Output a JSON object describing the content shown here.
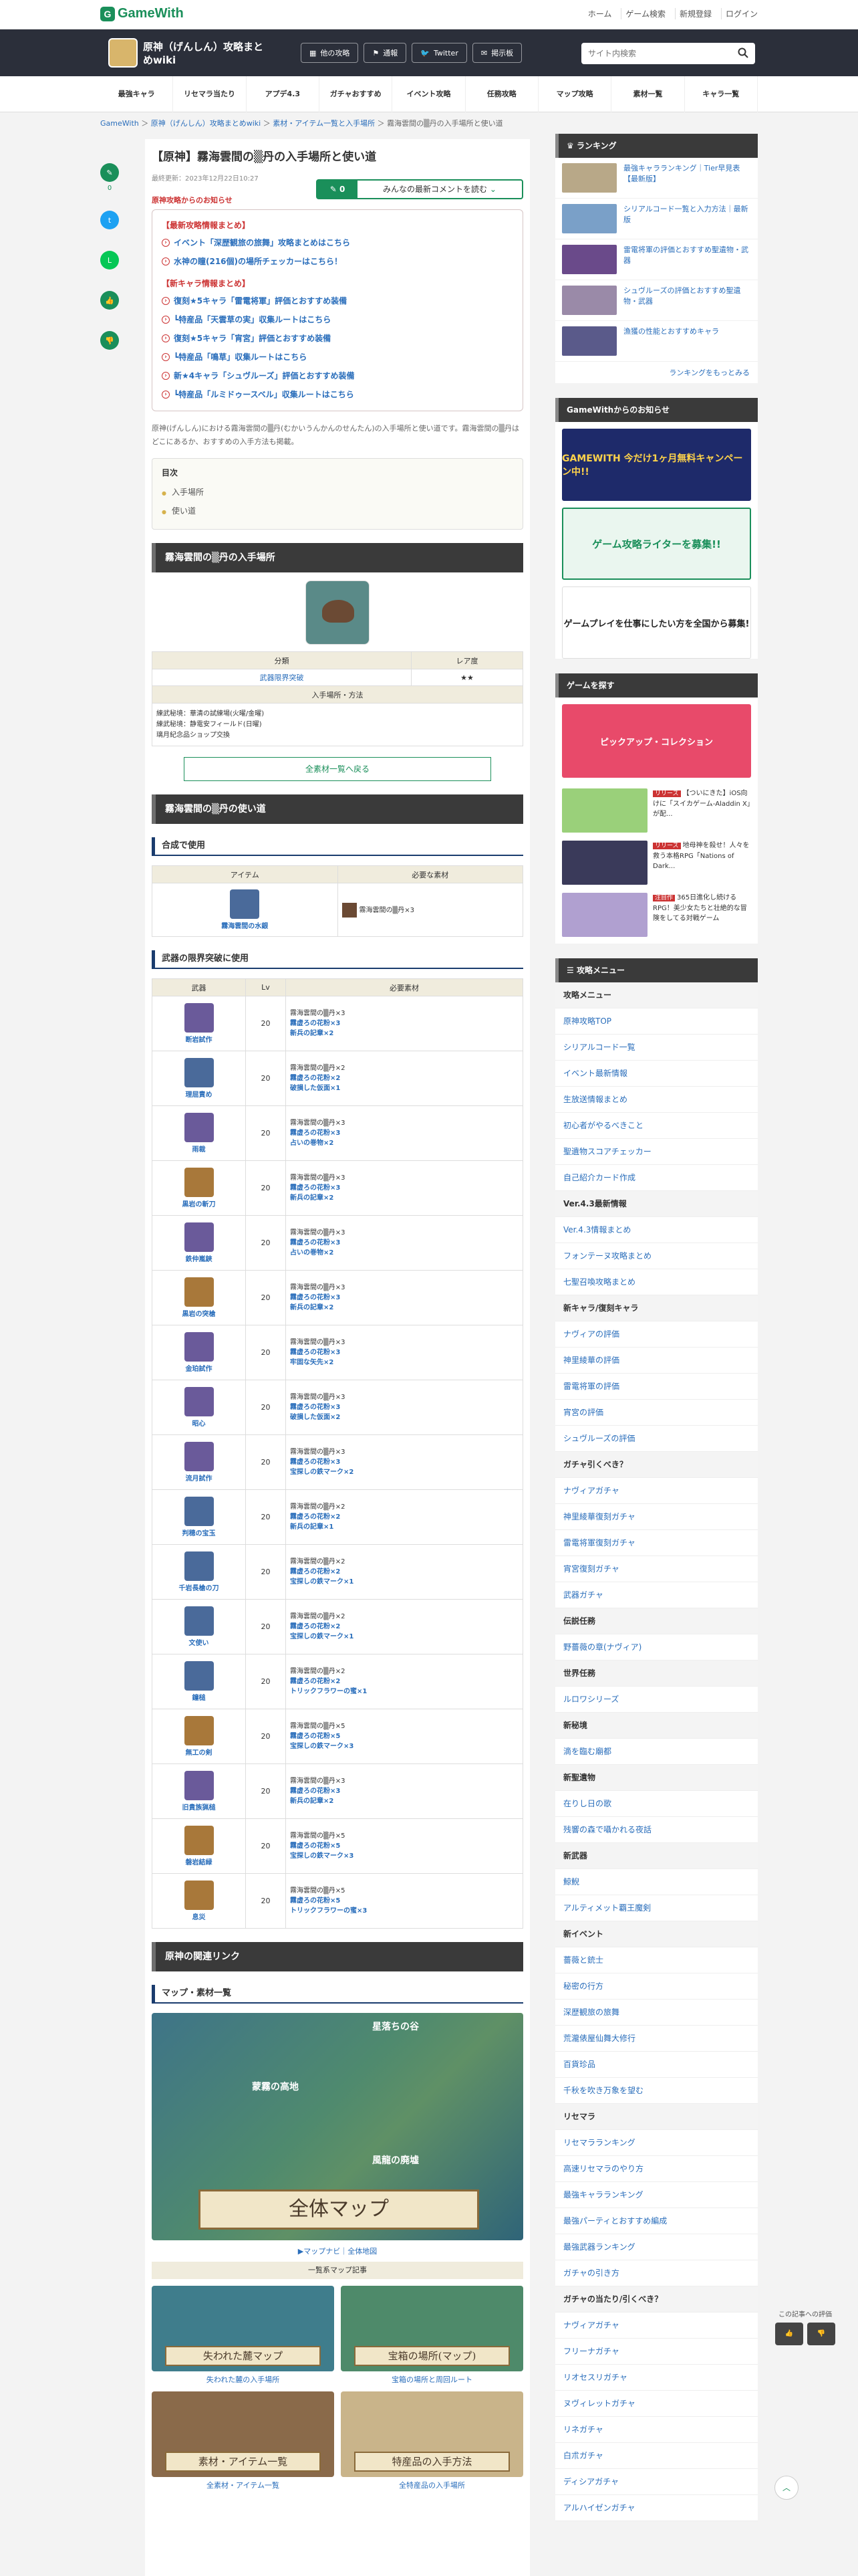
{
  "site": {
    "logo": "GameWith"
  },
  "topnav": {
    "home": "ホーム",
    "game_search": "ゲーム検索",
    "register": "新規登録",
    "login": "ログイン"
  },
  "game": {
    "title": "原神（げんしん）攻略まとめwiki",
    "buttons": [
      "他の攻略",
      "通報",
      "Twitter",
      "掲示板"
    ],
    "search_placeholder": "サイト内検索"
  },
  "tabs": [
    "最強キャラ",
    "リセマラ当たり",
    "アプデ4.3",
    "ガチャおすすめ",
    "イベント攻略",
    "任務攻略",
    "マップ攻略",
    "素材一覧",
    "キャラ一覧"
  ],
  "breadcrumb": [
    "GameWith",
    "原神（げんしん）攻略まとめwiki",
    "素材・アイテム一覧と入手場所",
    "霧海雲間の▒丹の入手場所と使い道"
  ],
  "share": {
    "comment_count": "0"
  },
  "article": {
    "title": "【原神】霧海雲間の▒丹の入手場所と使い道",
    "updated": "最終更新：2023年12月22日10:27",
    "comments": {
      "count": "0",
      "label": "みんなの最新コメントを読む"
    },
    "notice_head": "原神攻略からのお知らせ",
    "notice_sec1": "【最新攻略情報まとめ】",
    "notice_sec1_items": [
      "イベント「深歴観旅の旅舞」攻略まとめはこちら",
      "水神の瞳(216個)の場所チェッカーはこちら！"
    ],
    "notice_sec2": "【新キャラ情報まとめ】",
    "notice_sec2_items": [
      "復刻★5キャラ「雷電将軍」評価とおすすめ装備",
      "┗特産品「天雲草の実」収集ルートはこちら",
      "復刻★5キャラ「宵宮」評価とおすすめ装備",
      "┗特産品「鳴草」収集ルートはこちら",
      "新★4キャラ「シュヴルーズ」評価とおすすめ装備",
      "┗特産品「ルミドゥースベル」収集ルートはこちら"
    ],
    "intro": "原神(げんしん)における霧海雲間の▒丹(むかいうんかんのせんたん)の入手場所と使い道です。霧海雲間の▒丹はどこにあるか、おすすめの入手方法も掲載。",
    "toc_title": "目次",
    "toc": [
      "入手場所",
      "使い道"
    ],
    "sec_get": "霧海雲間の▒丹の入手場所",
    "info_head_cls": "分類",
    "info_head_rarity": "レア度",
    "info_cls": "武器限界突破",
    "info_rarity": "★★",
    "info_method_head": "入手場所・方法",
    "info_method": "練武秘境：華清の試練場(火曜/金曜)\n練武秘境：静電安フィールド(日曜)\n璃月紀念品ショップ交換",
    "back_label": "全素材一覧へ戻る",
    "sec_use": "霧海雲間の▒丹の使い道",
    "h_craft": "合成で使用",
    "craft_head_item": "アイテム",
    "craft_head_mat": "必要な素材",
    "craft_item": "霧海雲間の水銀",
    "craft_mat": "霧海雲間の▒丹×3",
    "h_weapons": "武器の限界突破に使用",
    "w_head_weapon": "武器",
    "w_head_lv": "Lv",
    "w_head_mat": "必要素材",
    "weapons": [
      {
        "name": "断岩試作",
        "lv": "20",
        "m1": "霧海雲間の▒丹×3",
        "m2": "霧虚ろの花粉×3",
        "m3": "新兵の記章×2"
      },
      {
        "name": "理屈責め",
        "lv": "20",
        "m1": "霧海雲間の▒丹×2",
        "m2": "霧虚ろの花粉×2",
        "m3": "破損した仮面×1"
      },
      {
        "name": "雨裁",
        "lv": "20",
        "m1": "霧海雲間の▒丹×3",
        "m2": "霧虚ろの花粉×3",
        "m3": "占いの巻物×2"
      },
      {
        "name": "黒岩の斬刀",
        "lv": "20",
        "m1": "霧海雲間の▒丹×3",
        "m2": "霧虚ろの花粉×3",
        "m3": "新兵の記章×2"
      },
      {
        "name": "鉄仲嵐鋏",
        "lv": "20",
        "m1": "霧海雲間の▒丹×3",
        "m2": "霧虚ろの花粉×3",
        "m3": "占いの巻物×2"
      },
      {
        "name": "黒岩の突槍",
        "lv": "20",
        "m1": "霧海雲間の▒丹×3",
        "m2": "霧虚ろの花粉×3",
        "m3": "新兵の記章×2"
      },
      {
        "name": "金珀試作",
        "lv": "20",
        "m1": "霧海雲間の▒丹×3",
        "m2": "霧虚ろの花粉×3",
        "m3": "牢固な矢先×2"
      },
      {
        "name": "昭心",
        "lv": "20",
        "m1": "霧海雲間の▒丹×3",
        "m2": "霧虚ろの花粉×3",
        "m3": "破損した仮面×2"
      },
      {
        "name": "流月試作",
        "lv": "20",
        "m1": "霧海雲間の▒丹×3",
        "m2": "霧虚ろの花粉×3",
        "m3": "宝探しの鉄マーク×2"
      },
      {
        "name": "判穂の宝玉",
        "lv": "20",
        "m1": "霧海雲間の▒丹×2",
        "m2": "霧虚ろの花粉×2",
        "m3": "新兵の記章×1"
      },
      {
        "name": "千岩長槍の刀",
        "lv": "20",
        "m1": "霧海雲間の▒丹×2",
        "m2": "霧虚ろの花粉×2",
        "m3": "宝探しの鉄マーク×1"
      },
      {
        "name": "文使い",
        "lv": "20",
        "m1": "霧海雲間の▒丹×2",
        "m2": "霧虚ろの花粉×2",
        "m3": "宝探しの鉄マーク×1"
      },
      {
        "name": "鐘槌",
        "lv": "20",
        "m1": "霧海雲間の▒丹×2",
        "m2": "霧虚ろの花粉×2",
        "m3": "トリックフラワーの蜜×1"
      },
      {
        "name": "無工の剣",
        "lv": "20",
        "m1": "霧海雲間の▒丹×5",
        "m2": "霧虚ろの花粉×5",
        "m3": "宝探しの鉄マーク×3"
      },
      {
        "name": "旧貴族猟槌",
        "lv": "20",
        "m1": "霧海雲間の▒丹×3",
        "m2": "霧虚ろの花粉×3",
        "m3": "新兵の記章×2"
      },
      {
        "name": "磐岩結緑",
        "lv": "20",
        "m1": "霧海雲間の▒丹×5",
        "m2": "霧虚ろの花粉×5",
        "m3": "宝探しの鉄マーク×3"
      },
      {
        "name": "息災",
        "lv": "20",
        "m1": "霧海雲間の▒丹×5",
        "m2": "霧虚ろの花粉×5",
        "m3": "トリックフラワーの蜜×3"
      }
    ],
    "sec_related": "原神の関連リンク",
    "h_map": "マップ・素材一覧",
    "map_big_label": "全体マップ",
    "map_place1": "星落ちの谷",
    "map_place2": "蒙霧の高地",
    "map_place3": "風龍の廃墟",
    "map_links": "▶マップナビ｜全体地図",
    "map_list_cap": "一覧系マップ記事",
    "grid": [
      {
        "cap": "失われた麓マップ",
        "link": "失われた麓の入手場所"
      },
      {
        "cap": "宝箱の場所(マップ)",
        "link": "宝箱の場所と周回ルート"
      },
      {
        "cap": "素材・アイテム一覧",
        "link": "全素材・アイテム一覧"
      },
      {
        "cap": "特産品の入手方法",
        "link": "全特産品の入手場所"
      }
    ]
  },
  "sidebar": {
    "ranking_title": "ランキング",
    "ranking": [
      "最強キャラランキング｜Tier早見表【最新版】",
      "シリアルコード一覧と入力方法｜最新版",
      "雷電将軍の評価とおすすめ聖遺物・武器",
      "シュヴルーズの評価とおすすめ聖遺物・武器",
      "漁獲の性能とおすすめキャラ"
    ],
    "ranking_more": "ランキングをもっとみる",
    "news_title": "GameWithからのお知らせ",
    "banners": [
      "GAMEWITH 今だけ1ヶ月無料キャンペーン中!!",
      "ゲーム攻略ライターを募集!!",
      "ゲームプレイを仕事にしたい方を全国から募集!"
    ],
    "games_title": "ゲームを探す",
    "games_banner": "ピックアップ・コレクション",
    "games": [
      {
        "tag": "リリース",
        "text": "【ついにきた】iOS向けに「スイカゲーム-Aladdin X」が配..."
      },
      {
        "tag": "リリース",
        "text": "地母神を殺せ！人々を救う本格RPG「Nations of Dark..."
      },
      {
        "tag": "注目作",
        "text": "365日進化し続けるRPG！美少女たちと壮絶的な冒険をしてる対戦ゲーム"
      }
    ],
    "menu_title": "攻略メニュー",
    "menu_head": "攻略メニュー",
    "menu": [
      {
        "t": "link",
        "v": "原神攻略TOP"
      },
      {
        "t": "link",
        "v": "シリアルコード一覧"
      },
      {
        "t": "link",
        "v": "イベント最新情報"
      },
      {
        "t": "link",
        "v": "生放送情報まとめ"
      },
      {
        "t": "link",
        "v": "初心者がやるべきこと"
      },
      {
        "t": "link",
        "v": "聖遺物スコアチェッカー"
      },
      {
        "t": "link",
        "v": "自己紹介カード作成"
      },
      {
        "t": "cat",
        "v": "Ver.4.3最新情報"
      },
      {
        "t": "link",
        "v": "Ver.4.3情報まとめ"
      },
      {
        "t": "link",
        "v": "フォンテーヌ攻略まとめ"
      },
      {
        "t": "link",
        "v": "七聖召喚攻略まとめ"
      },
      {
        "t": "cat",
        "v": "新キャラ/復刻キャラ"
      },
      {
        "t": "link",
        "v": "ナヴィアの評価"
      },
      {
        "t": "link",
        "v": "神里綾華の評価"
      },
      {
        "t": "link",
        "v": "雷電将軍の評価"
      },
      {
        "t": "link",
        "v": "宵宮の評価"
      },
      {
        "t": "link",
        "v": "シュヴルーズの評価"
      },
      {
        "t": "cat",
        "v": "ガチャ引くべき？"
      },
      {
        "t": "link",
        "v": "ナヴィアガチャ"
      },
      {
        "t": "link",
        "v": "神里綾華復刻ガチャ"
      },
      {
        "t": "link",
        "v": "雷電将軍復刻ガチャ"
      },
      {
        "t": "link",
        "v": "宵宮復刻ガチャ"
      },
      {
        "t": "link",
        "v": "武器ガチャ"
      },
      {
        "t": "cat",
        "v": "伝説任務"
      },
      {
        "t": "link",
        "v": "野薔薇の章(ナヴィア)"
      },
      {
        "t": "cat",
        "v": "世界任務"
      },
      {
        "t": "link",
        "v": "ルロワシリーズ"
      },
      {
        "t": "cat",
        "v": "新秘境"
      },
      {
        "t": "link",
        "v": "滴を臨む廟都"
      },
      {
        "t": "cat",
        "v": "新聖遺物"
      },
      {
        "t": "link",
        "v": "在りし日の歌"
      },
      {
        "t": "link",
        "v": "残響の森で囁かれる夜話"
      },
      {
        "t": "cat",
        "v": "新武器"
      },
      {
        "t": "link",
        "v": "鯨鯢"
      },
      {
        "t": "link",
        "v": "アルティメット覇王魔剣"
      },
      {
        "t": "cat",
        "v": "新イベント"
      },
      {
        "t": "link",
        "v": "薔薇と銃士"
      },
      {
        "t": "link",
        "v": "秘密の行方"
      },
      {
        "t": "link",
        "v": "深歴観旅の旅舞"
      },
      {
        "t": "link",
        "v": "荒瀧俵屋仙舞大修行"
      },
      {
        "t": "link",
        "v": "百貨珍品"
      },
      {
        "t": "link",
        "v": "千秋を吹き万象を望む"
      },
      {
        "t": "cat",
        "v": "リセマラ"
      },
      {
        "t": "link",
        "v": "リセマラランキング"
      },
      {
        "t": "link",
        "v": "高速リセマラのやり方"
      },
      {
        "t": "link",
        "v": "最強キャラランキング"
      },
      {
        "t": "link",
        "v": "最強パーティとおすすめ編成"
      },
      {
        "t": "link",
        "v": "最強武器ランキング"
      },
      {
        "t": "link",
        "v": "ガチャの引き方"
      },
      {
        "t": "cat",
        "v": "ガチャの当たり/引くべき？"
      },
      {
        "t": "link",
        "v": "ナヴィアガチャ"
      },
      {
        "t": "link",
        "v": "フリーナガチャ"
      },
      {
        "t": "link",
        "v": "リオセスリガチャ"
      },
      {
        "t": "link",
        "v": "ヌヴィレットガチャ"
      },
      {
        "t": "link",
        "v": "リネガチャ"
      },
      {
        "t": "link",
        "v": "白朮ガチャ"
      },
      {
        "t": "link",
        "v": "ディシアガチャ"
      },
      {
        "t": "link",
        "v": "アルハイゼンガチャ"
      }
    ]
  },
  "eval": {
    "label": "この記事への評価"
  },
  "colors": {
    "brand": "#1a8f5a",
    "link": "#2a6ebb",
    "alert": "#cc3333"
  }
}
